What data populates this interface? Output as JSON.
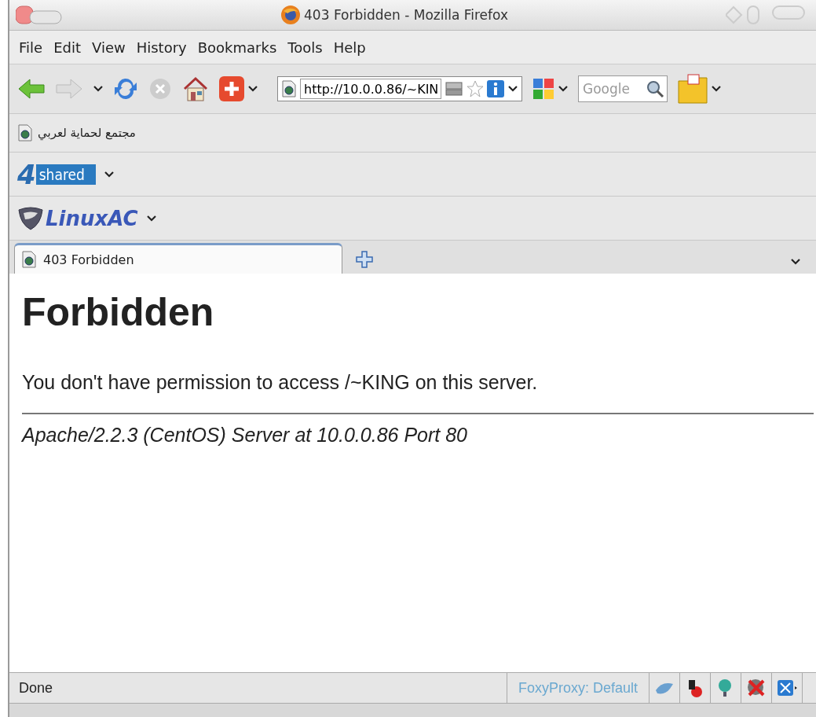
{
  "window": {
    "title": "403 Forbidden - Mozilla Firefox"
  },
  "menu": [
    {
      "label": "File"
    },
    {
      "label": "Edit"
    },
    {
      "label": "View"
    },
    {
      "label": "History"
    },
    {
      "label": "Bookmarks"
    },
    {
      "label": "Tools"
    },
    {
      "label": "Help"
    }
  ],
  "navigation": {
    "url": "http://10.0.0.86/~KIN",
    "search": {
      "placeholder": "Google"
    }
  },
  "bookmarks": [
    {
      "label": "مجتمع لحماية لعربي"
    }
  ],
  "toolbars": [
    {
      "kind": "fourshared",
      "logo_number": "4",
      "logo_text": "shared"
    },
    {
      "kind": "linuxac",
      "logo_text": "LinuxAC"
    }
  ],
  "tabs": [
    {
      "label": "403 Forbidden",
      "selected": true
    }
  ],
  "page": {
    "heading": "Forbidden",
    "message": "You don't have permission to access /~KING on this server.",
    "footer": "Apache/2.2.3 (CentOS) Server at 10.0.0.86 Port 80"
  },
  "status_bar": {
    "text": "Done",
    "proxy": "FoxyProxy: Default"
  }
}
